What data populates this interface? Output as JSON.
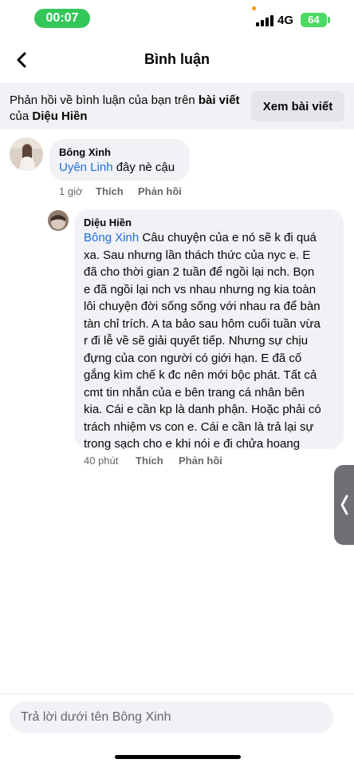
{
  "status_bar": {
    "time": "00:07",
    "network": "4G",
    "battery": "64",
    "colors": {
      "time_pill": "#33c759",
      "battery": "#4cd964"
    }
  },
  "header": {
    "back_icon": "chevron-left-icon",
    "title": "Bình luận"
  },
  "context": {
    "text_prefix": "Phản hồi về bình luận của bạn trên ",
    "post_link": "bài viết",
    "text_middle": " của ",
    "author": "Diệu Hiền",
    "view_post_button": "Xem bài viết"
  },
  "comments": [
    {
      "author": "Bông Xinh",
      "mention": "Uyên Linh",
      "text": " đây nè cậu",
      "time": "1 giờ",
      "like_label": "Thích",
      "reply_label": "Phản hồi"
    },
    {
      "author": "Diệu Hiền",
      "mention": "Bông Xinh",
      "lines": [
        " Câu chuyện của e nó sẽ k đi quá",
        "xa. Sau nhưng lần thách thức của nyc e. E",
        "đã cho thời gian 2 tuần để ngồi lại nch. Bọn",
        "e đã ngồi lại nch vs nhau nhưng ng kia toàn",
        "lôi chuyện đời sống sống với nhau ra để bàn",
        "tàn chỉ trích. A ta bảo sau hôm cuối tuần vừa",
        "r đi lễ về sẽ giải quyết tiếp. Nhưng sự chịu",
        "đựng của con người có giới hạn. E đã cố",
        "gắng kìm chế k đc nên mới bộc phát. Tất cả",
        "cmt tin nhắn của e bên trang cá nhân bên",
        "kia. Cái e cần kp là danh phận. Hoặc phải có",
        "trách nhiệm vs con e. Cái e cần là trả lại sự",
        "trong sạch cho e khi nói e đi chửa hoang"
      ],
      "time": "40 phút",
      "like_label": "Thích",
      "reply_label": "Phản hồi"
    }
  ],
  "side_handle_icon": "chevron-left-icon",
  "reply_box": {
    "placeholder": "Trả lời dưới tên Bông Xinh"
  },
  "colors": {
    "mention": "#216fdb",
    "bubble": "#f0f2f5",
    "meta": "#65676b"
  }
}
